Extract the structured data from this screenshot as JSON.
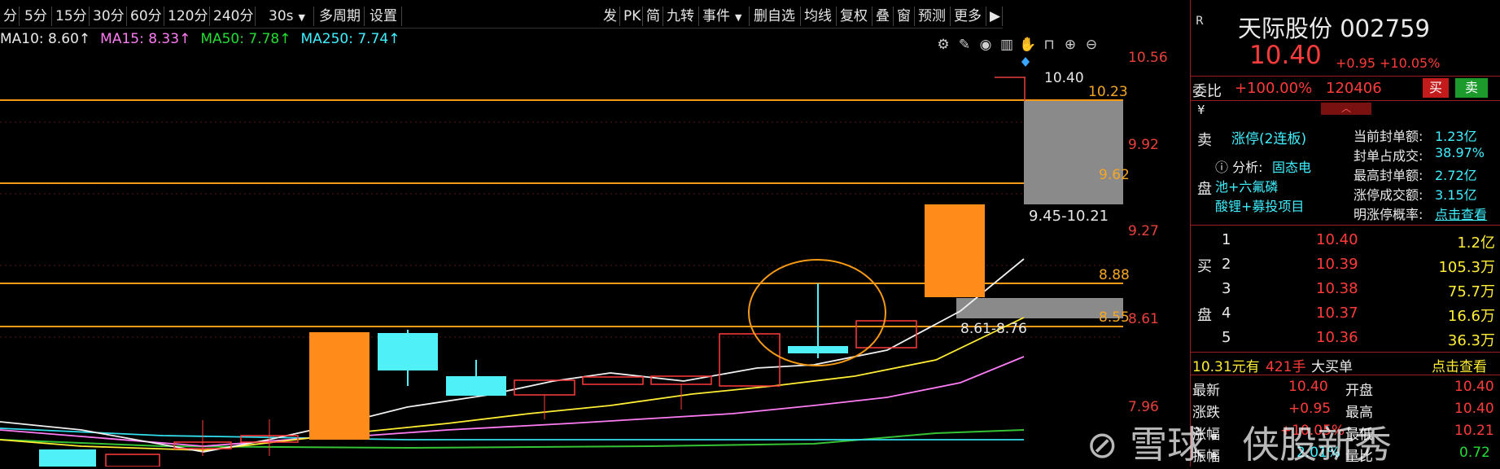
{
  "toolbar": {
    "periods": [
      "分",
      "5分",
      "15分",
      "30分",
      "60分",
      "120分",
      "240分"
    ],
    "dropdown_30s": "30s",
    "multi_period": "多周期",
    "settings": "设置",
    "right_buttons": [
      "发",
      "PK",
      "简",
      "九转",
      "事件"
    ],
    "right_buttons2": [
      "删自选",
      "均线",
      "复权",
      "叠",
      "窗",
      "预测",
      "更多"
    ]
  },
  "ma": {
    "ma10": "MA10: 8.60↑",
    "ma15": "MA15: 8.33↑",
    "ma50": "MA50: 7.78↑",
    "ma250": "MA250: 7.74↑"
  },
  "axis_labels": [
    "10.56",
    "9.92",
    "9.27",
    "8.61",
    "7.96"
  ],
  "chart_levels": {
    "top": "10.40",
    "l1023": "10.23",
    "l962": "9.62",
    "range1": "9.45-10.21",
    "l888": "8.88",
    "l855": "8.55",
    "range2": "8.61-8.76"
  },
  "stock": {
    "r_badge": "R",
    "name": "天际股份 002759",
    "price": "10.40",
    "change": "+0.95",
    "change_pct": "+10.05%",
    "weibi_label": "委比",
    "weibi_value": "+100.00%",
    "weibi_volume": "120406",
    "buy_btn": "买",
    "sell_btn": "卖",
    "yen": "¥",
    "sell_side_label": [
      "卖",
      "盘"
    ],
    "limit_status": "涨停(2连板)",
    "analysis_prefix": "ⓘ 分析:",
    "analysis_text": [
      "固态电",
      "池+六氟磷",
      "酸锂+募投项目"
    ],
    "seal_stats": [
      {
        "label": "当前封单额:",
        "value": "1.23亿"
      },
      {
        "label": "封单占成交:",
        "value": "38.97%"
      },
      {
        "label": "最高封单额:",
        "value": "2.72亿"
      },
      {
        "label": "涨停成交额:",
        "value": "3.15亿"
      },
      {
        "label": "明涨停概率:",
        "value": "点击查看"
      }
    ],
    "buy_side_label": [
      "买",
      "盘"
    ],
    "buy_orders": [
      {
        "level": "1",
        "price": "10.40",
        "vol": "1.2亿"
      },
      {
        "level": "2",
        "price": "10.39",
        "vol": "105.3万"
      },
      {
        "level": "3",
        "price": "10.38",
        "vol": "75.7万"
      },
      {
        "level": "4",
        "price": "10.37",
        "vol": "16.6万"
      },
      {
        "level": "5",
        "price": "10.36",
        "vol": "36.3万"
      }
    ],
    "big_order": {
      "price": "10.31元有",
      "lots": "421手",
      "label": "大买单",
      "link": "点击查看"
    },
    "quote": [
      {
        "l": "最新",
        "v": "10.40",
        "l2": "开盘",
        "v2": "10.40"
      },
      {
        "l": "涨跌",
        "v": "+0.95",
        "l2": "最高",
        "v2": "10.40"
      },
      {
        "l": "涨幅",
        "v": "+10.05%",
        "l2": "最低",
        "v2": "10.21"
      },
      {
        "l": "振幅",
        "v": "2.01%",
        "l2": "量比",
        "v2": "0.72"
      }
    ]
  },
  "watermark": "雪球：侠股新秀",
  "colors": {
    "up": "#ff3b3b",
    "down_candle": "#4ff0f8",
    "orange": "#ff8c1a",
    "level_line": "#f59a16"
  }
}
